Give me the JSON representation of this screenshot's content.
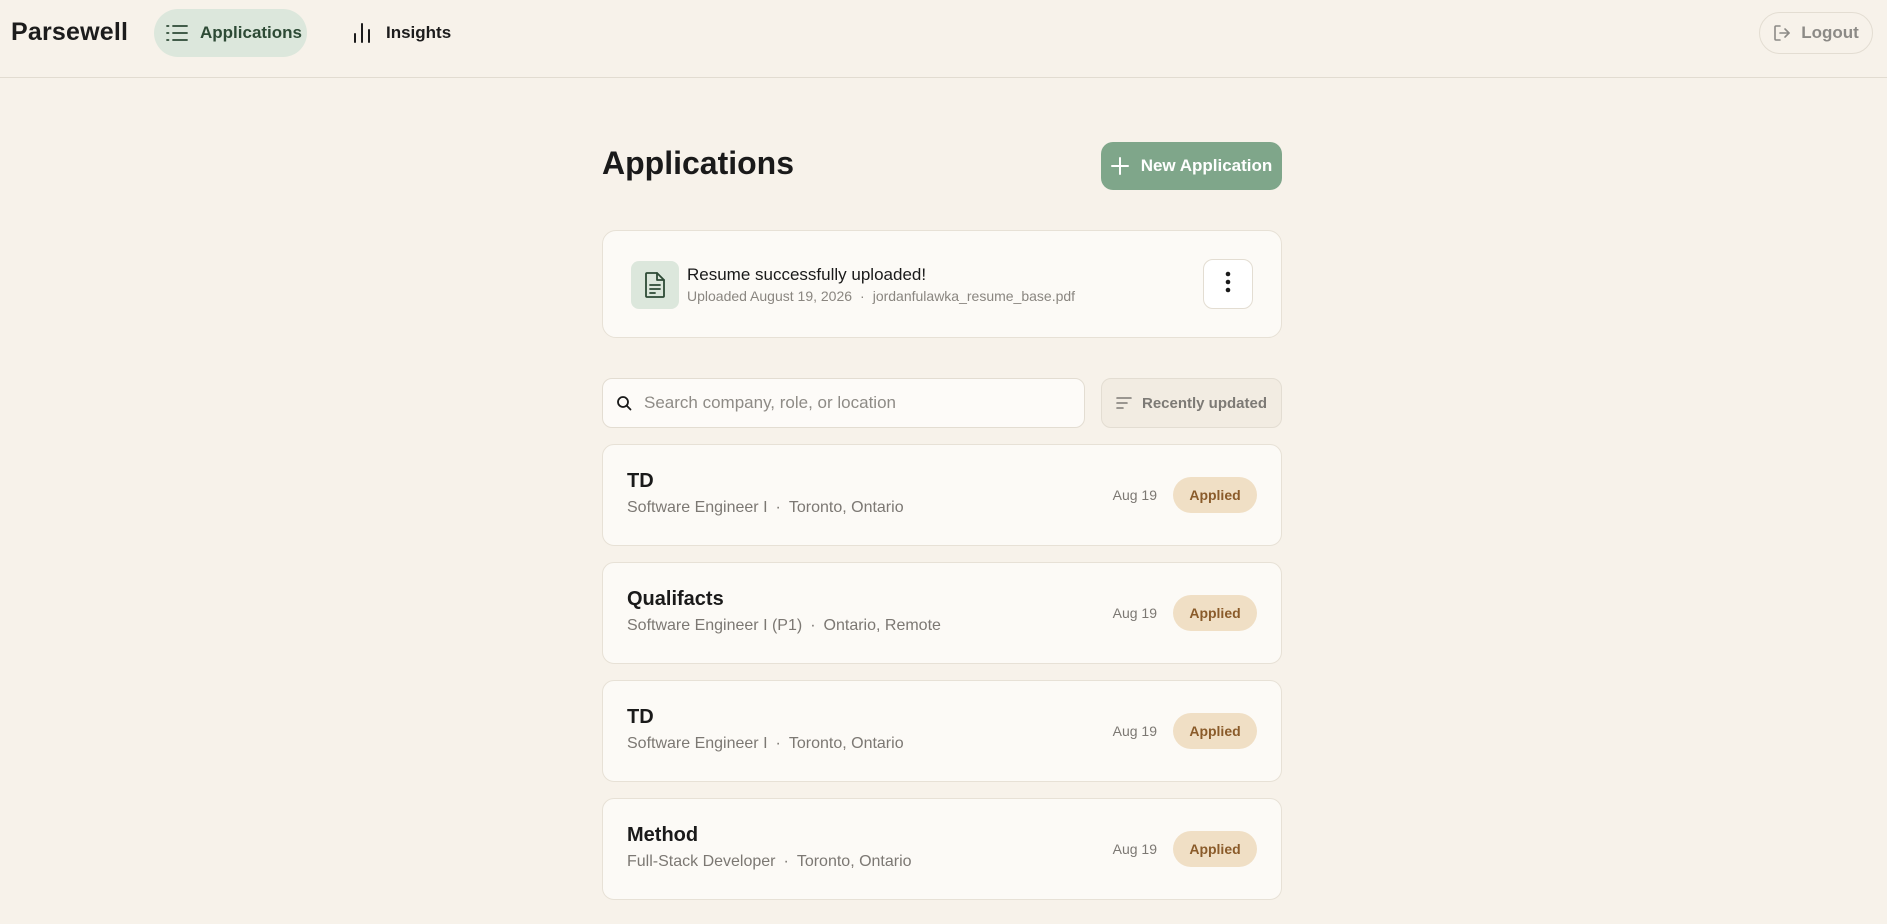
{
  "app": {
    "brand": "Parsewell"
  },
  "nav": {
    "applications_label": "Applications",
    "insights_label": "Insights",
    "logout_label": "Logout"
  },
  "page": {
    "title": "Applications",
    "new_application_label": "New Application"
  },
  "resume": {
    "title": "Resume successfully uploaded!",
    "uploaded_text": "Uploaded August 19, 2026",
    "separator": "·",
    "filename": "jordanfulawka_resume_base.pdf"
  },
  "search": {
    "value": "",
    "placeholder": "Search company, role, or location"
  },
  "sort": {
    "label": "Recently updated"
  },
  "applications": [
    {
      "company": "TD",
      "role": "Software Engineer I",
      "separator": "·",
      "location": "Toronto, Ontario",
      "date": "Aug 19",
      "status": "Applied"
    },
    {
      "company": "Qualifacts",
      "role": "Software Engineer I (P1)",
      "separator": "·",
      "location": "Ontario, Remote",
      "date": "Aug 19",
      "status": "Applied"
    },
    {
      "company": "TD",
      "role": "Software Engineer I",
      "separator": "·",
      "location": "Toronto, Ontario",
      "date": "Aug 19",
      "status": "Applied"
    },
    {
      "company": "Method",
      "role": "Full-Stack Developer",
      "separator": "·",
      "location": "Toronto, Ontario",
      "date": "Aug 19",
      "status": "Applied"
    }
  ],
  "colors": {
    "background": "#f7f2ea",
    "accent_green": "#7fa68a",
    "active_tab_bg": "#dce7dc",
    "status_badge_bg": "#f0dfc5",
    "status_badge_text": "#8a5b2a"
  },
  "icons": {
    "applications_tab": "list-icon",
    "insights_tab": "bar-chart-icon",
    "logout": "logout-icon",
    "new_application": "plus-icon",
    "resume": "document-icon",
    "resume_menu": "kebab-menu-icon",
    "search": "search-icon",
    "sort": "sort-lines-icon"
  }
}
